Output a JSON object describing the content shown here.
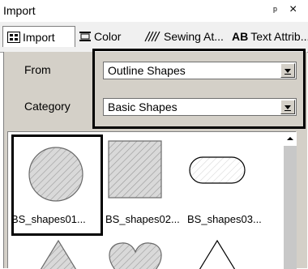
{
  "window": {
    "title": "Import",
    "pin_icon": "pin-icon",
    "close_icon": "close-icon"
  },
  "tabs": [
    {
      "label": "Import",
      "icon": "import-icon",
      "active": true
    },
    {
      "label": "Color",
      "icon": "color-icon",
      "active": false
    },
    {
      "label": "Sewing At...",
      "icon": "sewing-icon",
      "active": false
    },
    {
      "label": "Text Attrib...",
      "icon_text": "AB",
      "active": false
    }
  ],
  "form": {
    "from_label": "From",
    "from_value": "Outline Shapes",
    "category_label": "Category",
    "category_value": "Basic Shapes"
  },
  "gallery": {
    "items": [
      {
        "name": "BS_shapes01...",
        "shape": "circle"
      },
      {
        "name": "BS_shapes02...",
        "shape": "square"
      },
      {
        "name": "BS_shapes03...",
        "shape": "rounded-rect"
      }
    ],
    "partial_shapes": [
      "triangle",
      "heart",
      "triangle"
    ]
  },
  "colors": {
    "panel": "#d4d0c8",
    "shape_fill": "#d9d9d9",
    "hatch": "#9a9a9a"
  }
}
